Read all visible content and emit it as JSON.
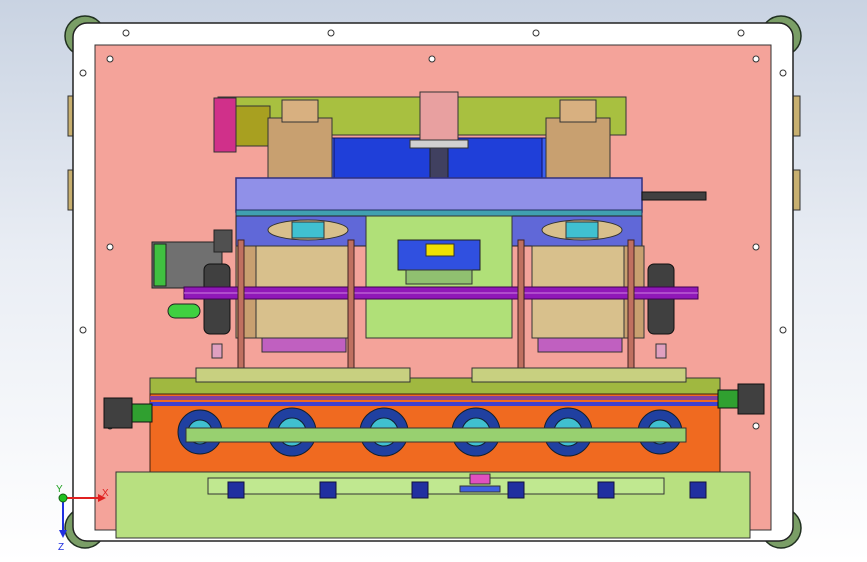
{
  "viewport": {
    "background_top": "#c9d3e2",
    "background_bottom": "#ffffff"
  },
  "triad": {
    "x_label": "X",
    "y_label": "Y",
    "z_label": "Z"
  },
  "colors": {
    "base_plate": "#f4a39a",
    "frame": "#ffffff",
    "corner_pads": "#7a9e66",
    "tan_blocks": "#d8c08c",
    "bronze": "#c8a070",
    "blue_plate": "#1f3fd9",
    "lavender_plate": "#9090e8",
    "lime": "#a8d060",
    "olive": "#a0b840",
    "orange": "#f06a20",
    "purple_rod": "#9018b8",
    "gear_cyan": "#40c0d0",
    "motor": "#707070",
    "magenta_block": "#e050c0",
    "bottom_plate": "#b8e080",
    "green_pill": "#40d040",
    "yellow": "#f0e000"
  }
}
